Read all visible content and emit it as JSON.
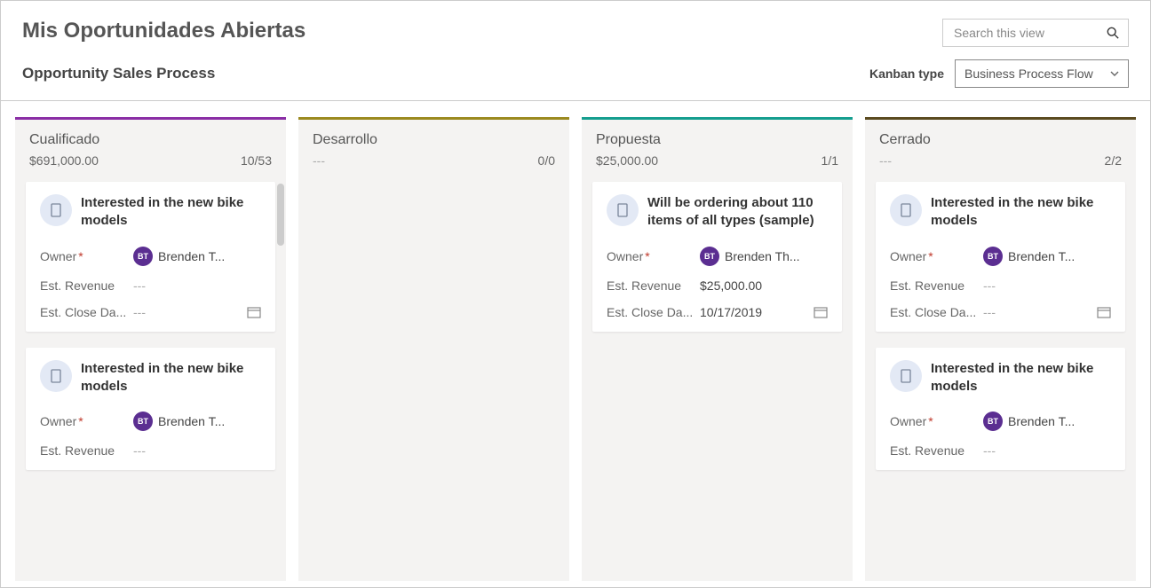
{
  "header": {
    "title": "Mis Oportunidades Abiertas",
    "search_placeholder": "Search this view"
  },
  "subheader": {
    "title": "Opportunity Sales Process",
    "kanban_label": "Kanban type",
    "kanban_value": "Business Process Flow"
  },
  "labels": {
    "owner": "Owner",
    "est_revenue": "Est. Revenue",
    "est_close": "Est. Close Da...",
    "empty": "---"
  },
  "owner": {
    "initials": "BT",
    "name_short_1": "Brenden T...",
    "name_short_2": "Brenden Th..."
  },
  "columns": [
    {
      "title": "Cualificado",
      "total": "$691,000.00",
      "count": "10/53"
    },
    {
      "title": "Desarrollo",
      "total": "---",
      "count": "0/0"
    },
    {
      "title": "Propuesta",
      "total": "$25,000.00",
      "count": "1/1"
    },
    {
      "title": "Cerrado",
      "total": "---",
      "count": "2/2"
    }
  ],
  "cards": {
    "bike": {
      "title": "Interested in the new bike models"
    },
    "order": {
      "title": "Will be ordering about 110 items of all types (sample)",
      "revenue": "$25,000.00",
      "close_date": "10/17/2019"
    }
  }
}
